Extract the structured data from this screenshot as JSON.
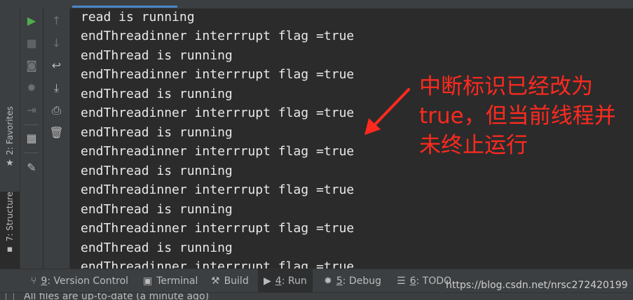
{
  "left_bar": {
    "favorites_label": "2: Favorites",
    "structure_label": "7: Structure"
  },
  "run_toolbar": {
    "rerun_icon": "play-icon",
    "stop_icon": "stop-icon",
    "snapshot_icon": "camera-icon",
    "debug_icon": "bug-icon",
    "login_icon": "enter-icon",
    "layout_icon": "layout-icon",
    "pin_icon": "pin-icon",
    "up_icon": "arrow-up-icon",
    "down_icon": "arrow-down-icon",
    "wrap_icon": "soft-wrap-icon",
    "scroll_end_icon": "scroll-to-end-icon",
    "print_icon": "print-icon",
    "trash_icon": "trash-icon"
  },
  "console": {
    "lines": [
      "read is running",
      "endThreadinner interrrupt flag =true",
      "endThread is running",
      "endThreadinner interrrupt flag =true",
      "endThread is running",
      "endThreadinner interrrupt flag =true",
      "endThread is running",
      "endThreadinner interrrupt flag =true",
      "endThread is running",
      "endThreadinner interrrupt flag =true",
      "endThread is running",
      "endThreadinner interrrupt flag =true",
      "endThread is running",
      "endThreadinner interrrupt flag =true"
    ]
  },
  "annotation": {
    "line1": "中断标识已经改为",
    "line2": "true，但当前线程并",
    "line3": "未终止运行",
    "color": "#ff2a1f"
  },
  "bottom_bar": {
    "tabs": [
      {
        "num": "9",
        "label": ": Version Control"
      },
      {
        "num": "",
        "label": "Terminal"
      },
      {
        "num": "",
        "label": "Build"
      },
      {
        "num": "4",
        "label": ": Run"
      },
      {
        "num": "5",
        "label": ": Debug"
      },
      {
        "num": "6",
        "label": ": TODO"
      }
    ],
    "watermark": "https://blog.csdn.net/nrsc272420199"
  },
  "status_bar": {
    "text": "All files are up-to-date (a minute ago)"
  }
}
